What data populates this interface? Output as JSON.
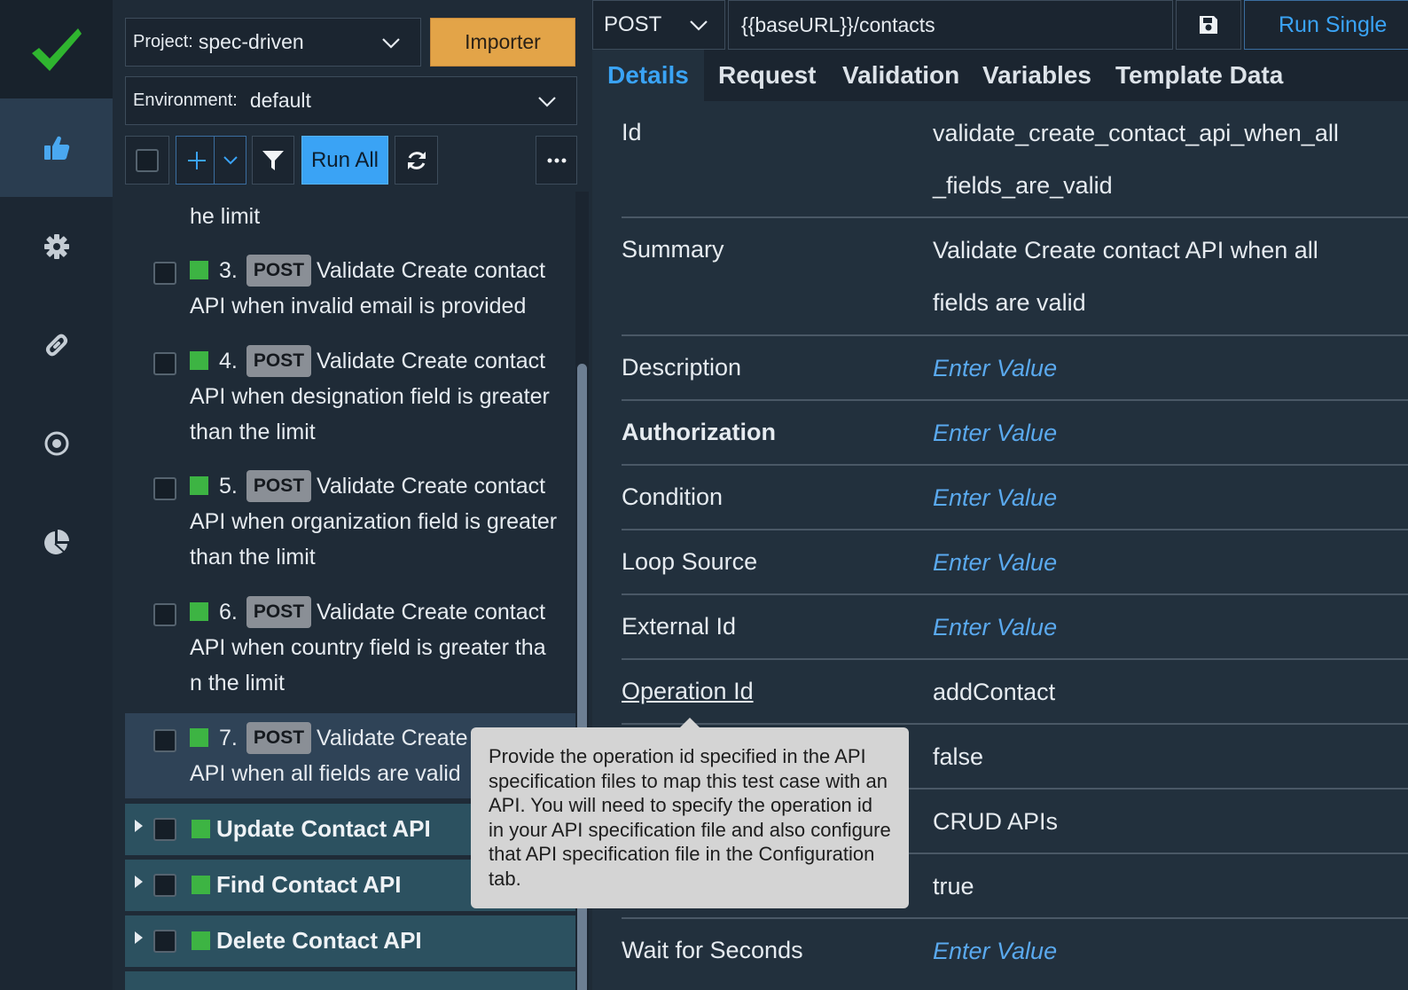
{
  "rail": {
    "items": [
      "logo-check",
      "thumbs-up",
      "settings",
      "link",
      "target",
      "pie-chart"
    ],
    "active": "thumbs-up"
  },
  "project": {
    "label": "Project:",
    "value": "spec-driven"
  },
  "importer_label": "Importer",
  "environment": {
    "label": "Environment:",
    "value": "default"
  },
  "toolbar": {
    "run_all_label": "Run All"
  },
  "cases": [
    {
      "wrapped_tail": "he limit"
    },
    {
      "num": "3.",
      "method": "POST",
      "line1": "Validate Create contact",
      "line2": "API when invalid email is provided",
      "line3": ""
    },
    {
      "num": "4.",
      "method": "POST",
      "line1": "Validate Create contact",
      "line2": "API when designation field is greater",
      "line3": "than the limit"
    },
    {
      "num": "5.",
      "method": "POST",
      "line1": "Validate Create contact",
      "line2": "API when organization field is greater",
      "line3": "than the limit"
    },
    {
      "num": "6.",
      "method": "POST",
      "line1": "Validate Create contact",
      "line2": "API when country field is greater tha",
      "line3": "n the limit"
    },
    {
      "num": "7.",
      "method": "POST",
      "line1": "Validate Create",
      "line2": "API when all fields are valid",
      "line3": ""
    }
  ],
  "groups": [
    "Update Contact API",
    "Find Contact API",
    "Delete Contact API"
  ],
  "request": {
    "method": "POST",
    "url": "{{baseURL}}/contacts",
    "run_single_label": "Run Single"
  },
  "tabs": [
    "Details",
    "Request",
    "Validation",
    "Variables",
    "Template Data"
  ],
  "active_tab": "Details",
  "details": [
    {
      "key": "Id",
      "value": "validate_create_contact_api_when_all_fields_are_valid"
    },
    {
      "key": "Summary",
      "value": "Validate Create contact API when all fields are valid"
    },
    {
      "key": "Description",
      "value": "Enter Value"
    },
    {
      "key": "Authorization",
      "value": "Enter Value"
    },
    {
      "key": "Condition",
      "value": "Enter Value"
    },
    {
      "key": "Loop Source",
      "value": "Enter Value"
    },
    {
      "key": "External Id",
      "value": "Enter Value"
    },
    {
      "key": "Operation Id",
      "value": "addContact"
    },
    {
      "key": "",
      "value": "false"
    },
    {
      "key": "",
      "value": "CRUD APIs"
    },
    {
      "key": "",
      "value": "true"
    },
    {
      "key": "Wait for Seconds",
      "value": "Enter Value"
    }
  ],
  "tooltip": {
    "text": "Provide the operation id specified in the API specification files to map this test case with an API. You will need to specify the operation id in your API specification file and also configure that API specification file in the Configuration tab."
  },
  "colors": {
    "accent_blue": "#3aa3f5",
    "importer_orange": "#e3a448",
    "status_green": "#3db443",
    "logo_green": "#2fb52f",
    "group_teal": "#2c5160"
  }
}
